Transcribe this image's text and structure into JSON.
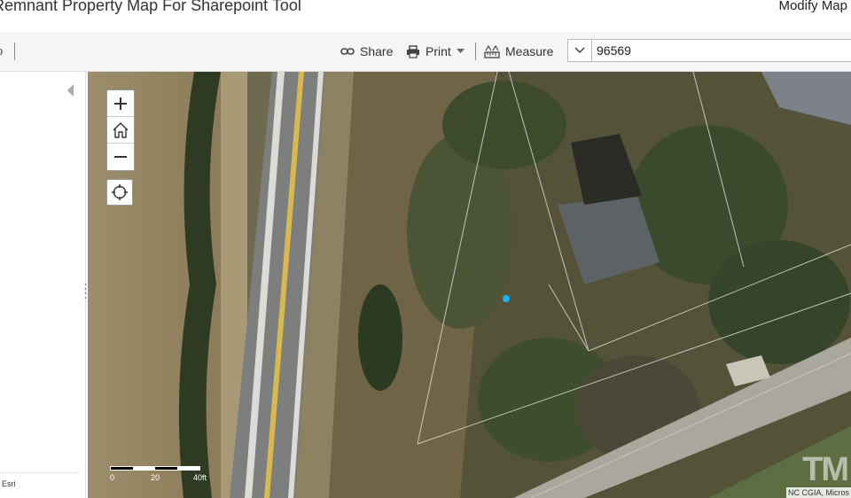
{
  "header": {
    "title": "Remnant Property Map For Sharepoint Tool",
    "modify_link": "Modify Map"
  },
  "toolbar": {
    "left_fragment": "o",
    "share_label": "Share",
    "print_label": "Print",
    "measure_label": "Measure",
    "search_value": "96569"
  },
  "map": {
    "scale_labels": [
      "0",
      "20",
      "40ft"
    ],
    "attribution": "NC CGIA, Micros",
    "watermark": "TM",
    "esri_label": "Esri"
  },
  "icons": {
    "zoom_in": "plus-icon",
    "home": "home-icon",
    "zoom_out": "minus-icon",
    "locate": "locate-icon",
    "share": "link-icon",
    "print": "printer-icon",
    "measure": "ruler-icon",
    "collapse": "chevron-left-icon"
  }
}
